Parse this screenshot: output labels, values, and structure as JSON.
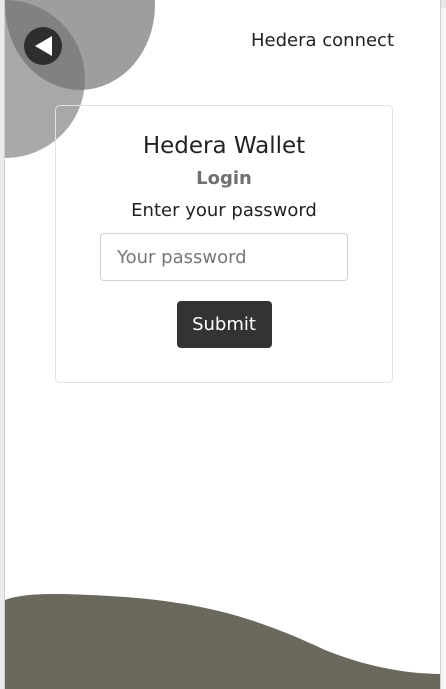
{
  "header": {
    "title": "Hedera connect",
    "back_icon": "back-arrow-icon"
  },
  "login": {
    "title": "Hedera Wallet",
    "subtitle": "Login",
    "prompt": "Enter your password",
    "password_placeholder": "Your password",
    "password_value": "",
    "submit_label": "Submit"
  },
  "colors": {
    "accent_dark": "#333333",
    "wave": "#6b695d",
    "deco_gray": "#787878"
  }
}
